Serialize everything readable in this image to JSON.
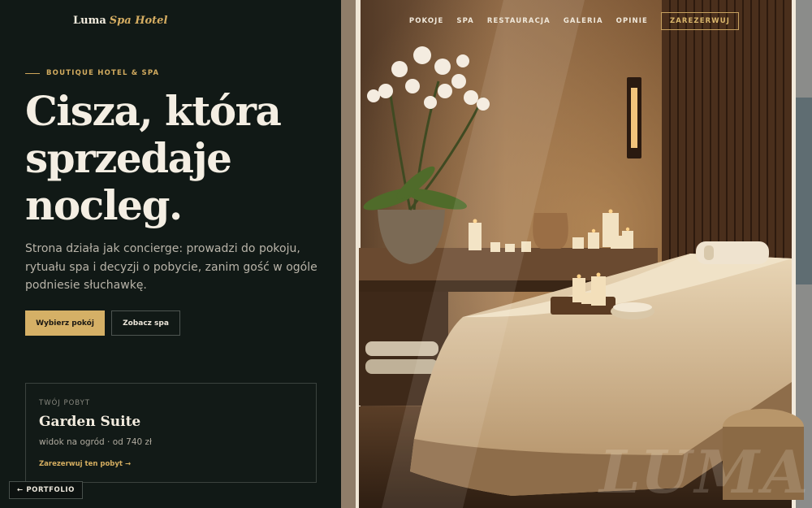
{
  "brand": {
    "name": "Luma",
    "accent": "Spa Hotel"
  },
  "nav": {
    "items": [
      "POKOJE",
      "SPA",
      "RESTAURACJA",
      "GALERIA",
      "OPINIE"
    ],
    "cta": "ZAREZERWUJ"
  },
  "hero": {
    "eyebrow": "BOUTIQUE HOTEL & SPA",
    "headline": [
      "Cisza, która",
      "sprzedaje",
      "nocleg."
    ],
    "lead": "Strona działa jak concierge: prowadzi do pokoju, rytuału spa i decyzji o pobycie, zanim gość w ogóle podniesie słuchawkę.",
    "primary_button": "Wybierz pokój",
    "secondary_button": "Zobacz spa"
  },
  "stay": {
    "label": "TWÓJ POBYT",
    "title": "Garden Suite",
    "meta": "widok na ogród · od 740 zł",
    "link": "Zarezerwuj ten pobyt →"
  },
  "portfolio_button": "← PORTFOLIO",
  "watermark": "LUMA",
  "colors": {
    "panel": "#111916",
    "gold": "#d5b066",
    "cream": "#f4eee3"
  }
}
